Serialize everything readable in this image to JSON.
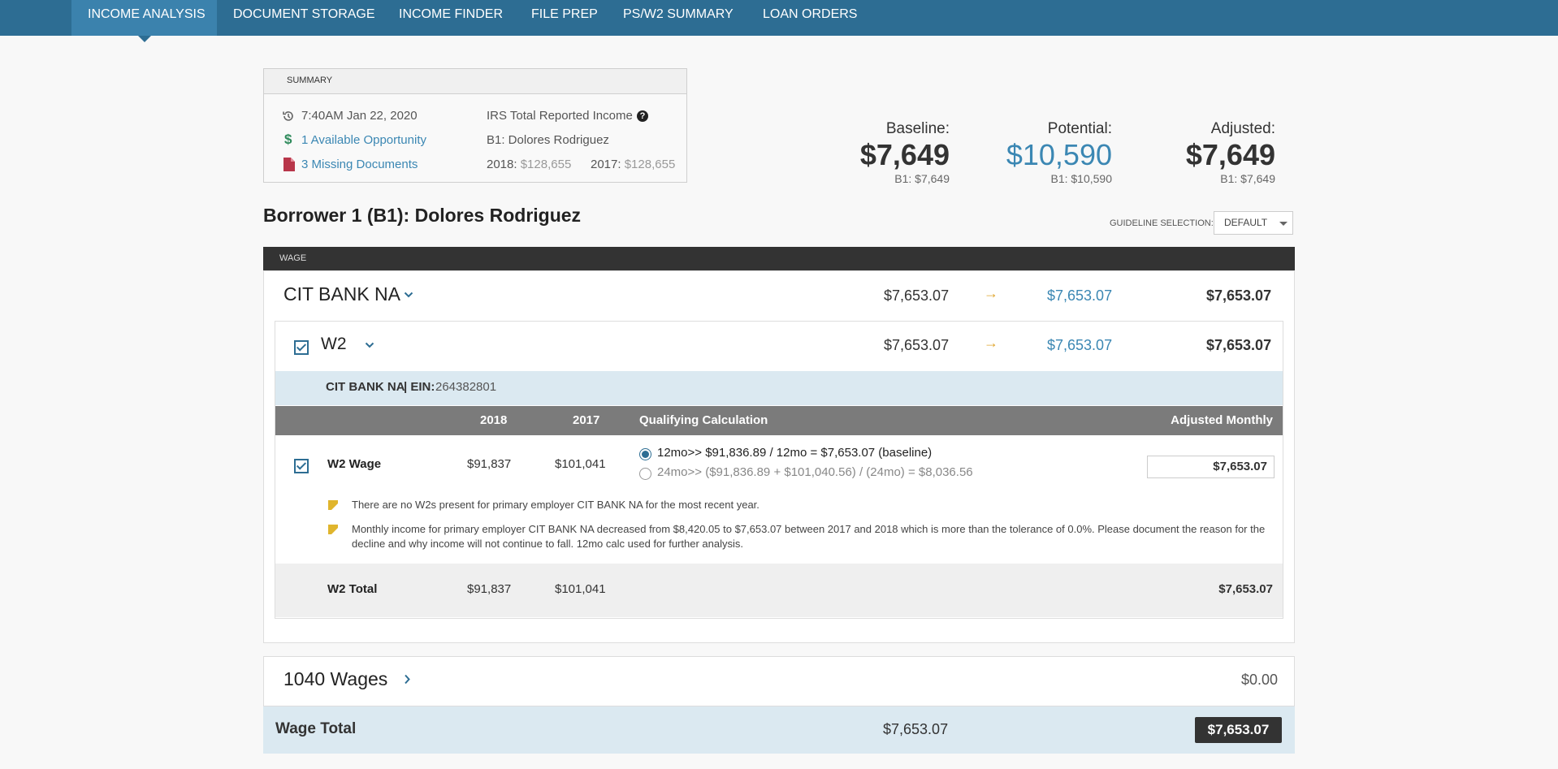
{
  "nav": {
    "tabs": [
      {
        "label": "INCOME ANALYSIS"
      },
      {
        "label": "DOCUMENT STORAGE"
      },
      {
        "label": "INCOME FINDER"
      },
      {
        "label": "FILE PREP"
      },
      {
        "label": "PS/W2 SUMMARY"
      },
      {
        "label": "LOAN ORDERS"
      }
    ]
  },
  "summary": {
    "title": "SUMMARY",
    "timestamp": "7:40AM Jan 22, 2020",
    "opportunity": "1 Available Opportunity",
    "missing_docs": "3 Missing Documents",
    "irs_label": "IRS Total Reported Income",
    "borrower": "B1: Dolores Rodriguez",
    "year1_label": "2018:",
    "year1_value": "$128,655",
    "year2_label": "2017:",
    "year2_value": "$128,655"
  },
  "totals": {
    "baseline_label": "Baseline:",
    "baseline_value": "$7,649",
    "baseline_sub": "B1: $7,649",
    "potential_label": "Potential:",
    "potential_value": "$10,590",
    "potential_sub": "B1: $10,590",
    "adjusted_label": "Adjusted:",
    "adjusted_value": "$7,649",
    "adjusted_sub": "B1: $7,649"
  },
  "borrower_title": "Borrower 1 (B1): Dolores Rodriguez",
  "guideline": {
    "label": "GUIDELINE SELECTION:",
    "value": "DEFAULT"
  },
  "wage_section": "WAGE",
  "employer": {
    "name": "CIT BANK NA",
    "baseline": "$7,653.07",
    "potential": "$7,653.07",
    "adjusted": "$7,653.07"
  },
  "w2": {
    "label": "W2",
    "baseline": "$7,653.07",
    "potential": "$7,653.07",
    "adjusted": "$7,653.07",
    "ein_name": "CIT BANK NA",
    "ein_label": "| EIN:",
    "ein_value": "264382801",
    "headers": {
      "y2018": "2018",
      "y2017": "2017",
      "calc": "Qualifying Calculation",
      "adj": "Adjusted Monthly"
    },
    "wage_row": {
      "label": "W2 Wage",
      "v2018": "$91,837",
      "v2017": "$101,041",
      "opt1": "12mo>> $91,836.89 / 12mo = $7,653.07 (baseline)",
      "opt2": "24mo>> ($91,836.89 + $101,040.56) / (24mo) = $8,036.56",
      "adjusted": "$7,653.07"
    },
    "notes": [
      "There are no W2s present for primary employer CIT BANK NA for the most recent year.",
      "Monthly income for primary employer CIT BANK NA decreased from $8,420.05 to $7,653.07 between 2017 and 2018 which is more than the tolerance of 0.0%. Please document the reason for the decline and why income will not continue to fall. 12mo calc used for further analysis."
    ],
    "total_row": {
      "label": "W2 Total",
      "v2018": "$91,837",
      "v2017": "$101,041",
      "adjusted": "$7,653.07"
    }
  },
  "wages1040": {
    "label": "1040 Wages",
    "value": "$0.00"
  },
  "wage_total": {
    "label": "Wage Total",
    "baseline": "$7,653.07",
    "adjusted": "$7,653.07"
  },
  "colors": {
    "nav": "#2d6d93",
    "accent_blue": "#3b87b3",
    "arrow": "#e0a52d",
    "missing": "#b8364a"
  }
}
